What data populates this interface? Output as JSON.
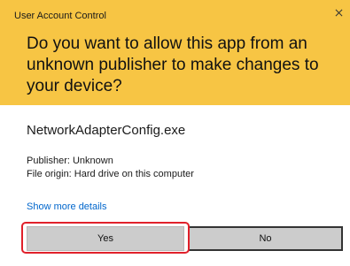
{
  "window": {
    "title": "User Account Control",
    "close_icon": "close-icon"
  },
  "header": {
    "question": "Do you want to allow this app from an unknown publisher to make changes to your device?",
    "background": "#f7c544"
  },
  "app": {
    "name": "NetworkAdapterConfig.exe",
    "publisher": "Publisher: Unknown",
    "file_origin": "File origin: Hard drive on this computer"
  },
  "details_link": "Show more details",
  "buttons": {
    "yes_label": "Yes",
    "no_label": "No"
  },
  "colors": {
    "link": "#0066cc",
    "highlight": "#e0202a",
    "button_bg": "#cccccc"
  }
}
